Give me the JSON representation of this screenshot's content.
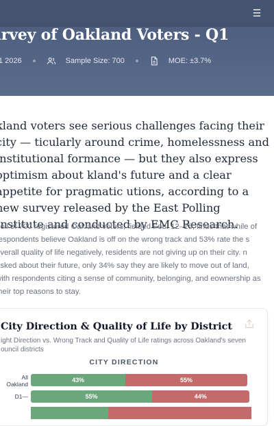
{
  "header": {
    "title": "urvey of Oakland Voters - Q1",
    "meta": {
      "date": "1 2026",
      "sample_size": "Sample Size: 700",
      "moe": "MOE: ±3.7%"
    }
  },
  "article": {
    "lead": "kland voters see serious challenges facing their city — ticularly around crime, homelessness and institutional formance — but they also express optimism about kland's future and a clear appetite for pragmatic utions, according to a new survey released by the East  Polling Institute and conducted by EMC Research.",
    "body": "poll of 700 registered Oakland voters, fielded Feb. 12–18, finds that while  of respondents believe Oakland is off on the wrong track and 53% rate the s overall quality of life negatively, residents are not giving up on their city.  n asked about their future, only 34% say they are likely to move out of land, with respondents citing a sense of community, belonging, and eownership as their top reasons to stay."
  },
  "card": {
    "title": "City Direction & Quality of Life by District",
    "subtitle": "ight Direction vs. Wrong Track and Quality of Life ratings across Oakland's seven ouncil districts",
    "section": "CITY DIRECTION",
    "share_icon": "share-icon"
  },
  "chart_data": {
    "type": "bar",
    "stacked": true,
    "orientation": "horizontal",
    "title": "City Direction",
    "categories": [
      "All Oakland",
      "D1"
    ],
    "series": [
      {
        "name": "Right Direction",
        "values": [
          43,
          55
        ],
        "color": "#6aa77a"
      },
      {
        "name": "Wrong Track",
        "values": [
          55,
          44
        ],
        "color": "#c46a6a"
      }
    ],
    "labels": [
      [
        "43%",
        "55%"
      ],
      [
        "55%",
        "44%"
      ]
    ],
    "xlim": [
      0,
      100
    ]
  },
  "colors": {
    "header_bg": "#5b6b8a",
    "topbar_bg": "#44546f",
    "green": "#6aa77a",
    "red": "#c46a6a"
  }
}
